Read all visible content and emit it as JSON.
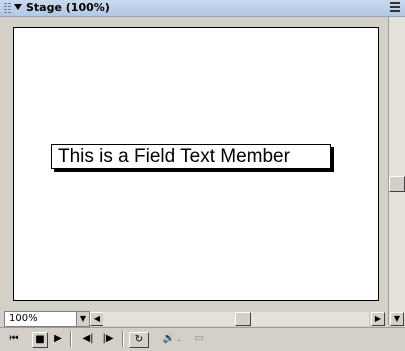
{
  "window": {
    "title": "Stage (100%)"
  },
  "stage": {
    "field_text": "This is a Field Text Member"
  },
  "zoom": {
    "value": "100%"
  },
  "controls": {
    "rewind_glyph": "⏮",
    "stop_glyph": "■",
    "play_glyph": "▶",
    "step_back_glyph": "◀|",
    "step_fwd_glyph": "|▶",
    "loop_glyph": "↻",
    "volume_glyph": "🔊"
  },
  "icons": {
    "collapse": "triangle-down-icon",
    "menu": "panel-menu-icon",
    "scroll_up": "▲",
    "scroll_down": "▼",
    "scroll_left": "◀",
    "scroll_right": "▶"
  }
}
